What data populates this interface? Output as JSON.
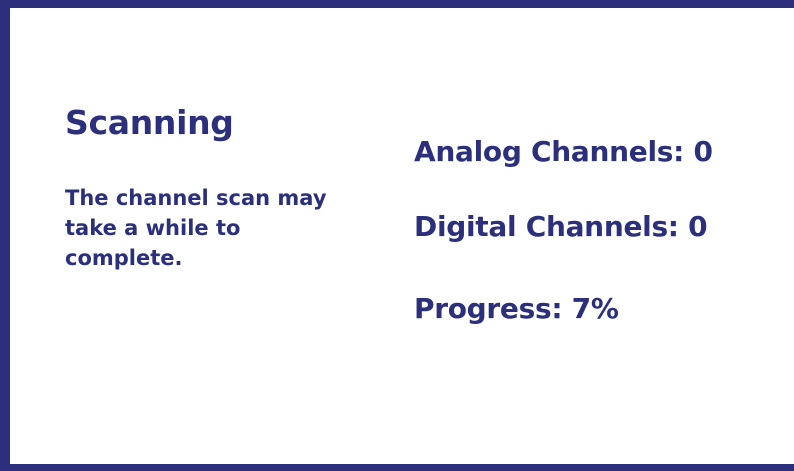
{
  "scan": {
    "title": "Scanning",
    "description": "The channel scan may take a while to complete.",
    "analog_channels": "Analog Channels: 0",
    "digital_channels": "Digital Channels: 0",
    "progress": "Progress: 7%",
    "progress_value": 0.07
  },
  "colors": {
    "accent": "#2c2f7c",
    "background": "#ffffff"
  }
}
